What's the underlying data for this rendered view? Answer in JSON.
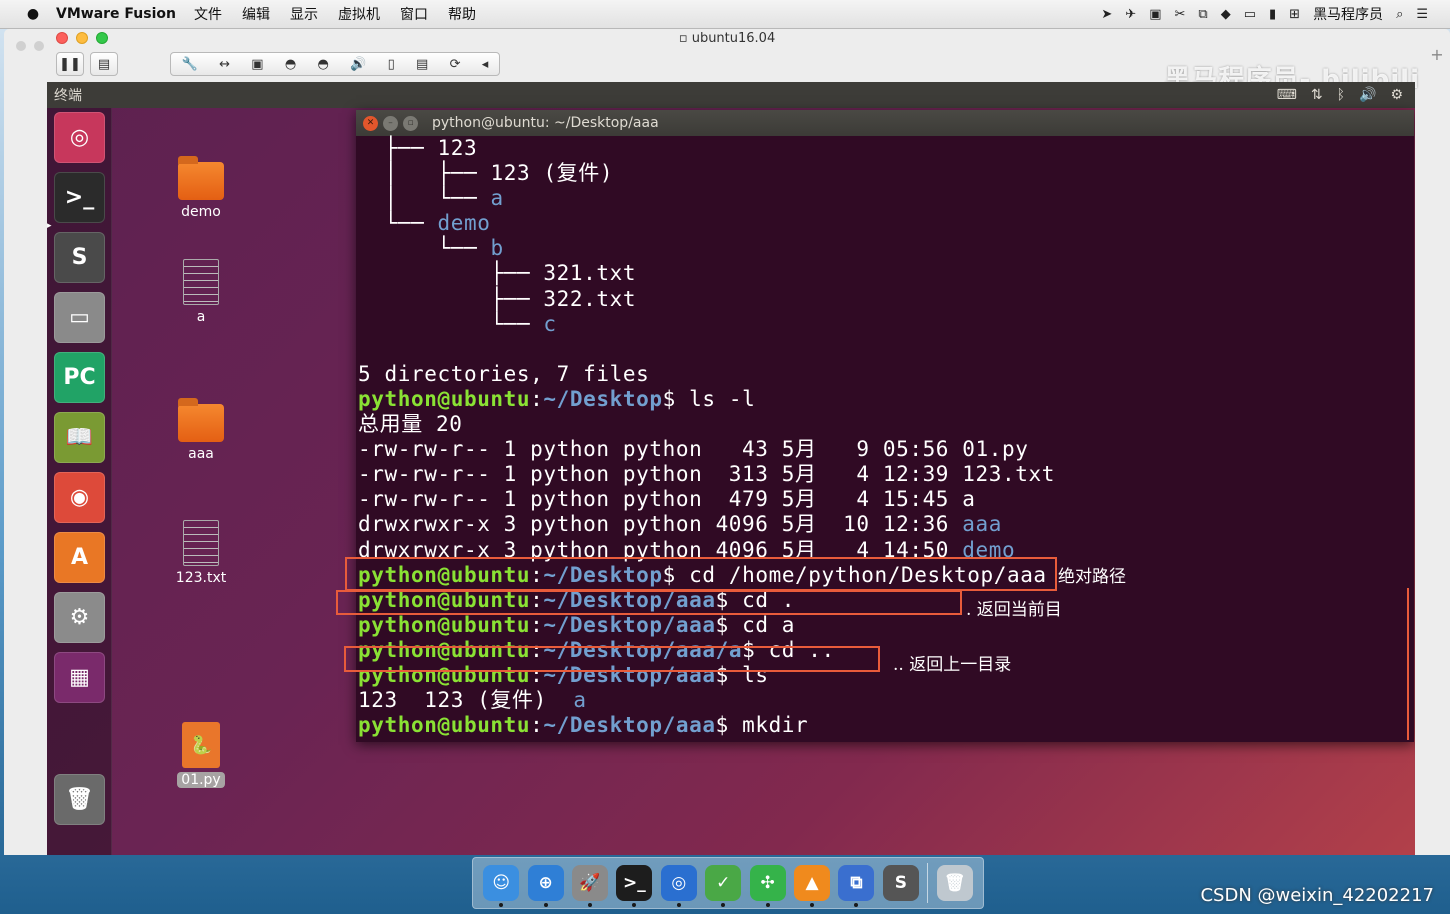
{
  "mac_menubar": {
    "app_name": "VMware Fusion",
    "menus": [
      "文件",
      "编辑",
      "显示",
      "虚拟机",
      "窗口",
      "帮助"
    ],
    "status_user": "黑马程序员"
  },
  "vm": {
    "title": "ubuntu16.04",
    "watermark": "黑马程序员- bilibili"
  },
  "ubuntu": {
    "panel_title": "终端",
    "launcher_items": [
      {
        "name": "ubuntu-dash",
        "glyph": "◎",
        "color": "#c7375c"
      },
      {
        "name": "terminal",
        "glyph": ">_",
        "color": "#2b2b2b"
      },
      {
        "name": "sublime-text",
        "glyph": "S",
        "color": "#4a4a4a"
      },
      {
        "name": "file-manager",
        "glyph": "▭",
        "color": "#8a8a8a"
      },
      {
        "name": "pycharm",
        "glyph": "PC",
        "color": "#21a366"
      },
      {
        "name": "ebook-reader",
        "glyph": "📖",
        "color": "#7a9a33"
      },
      {
        "name": "chrome",
        "glyph": "◉",
        "color": "#dd4a3a"
      },
      {
        "name": "software-center",
        "glyph": "A",
        "color": "#e97725"
      },
      {
        "name": "system-settings",
        "glyph": "⚙",
        "color": "#8b8b8b"
      },
      {
        "name": "workspace-switcher",
        "glyph": "▦",
        "color": "#7a2a6b"
      },
      {
        "name": "trash",
        "glyph": "🗑",
        "color": "#6a6a6a"
      }
    ],
    "desktop_icons": [
      {
        "label": "demo",
        "kind": "folder"
      },
      {
        "label": "a",
        "kind": "file"
      },
      {
        "label": "aaa",
        "kind": "folder"
      },
      {
        "label": "123.txt",
        "kind": "file"
      },
      {
        "label": "01.py",
        "kind": "python"
      }
    ]
  },
  "terminal": {
    "title": "python@ubuntu: ~/Desktop/aaa",
    "lines": [
      [
        {
          "t": "  ",
          "c": ""
        },
        {
          "t": "├── ",
          "c": "tr"
        },
        {
          "t": "123",
          "c": ""
        }
      ],
      [
        {
          "t": "  ",
          "c": ""
        },
        {
          "t": "│   ",
          "c": "tr"
        },
        {
          "t": "├── ",
          "c": "tr"
        },
        {
          "t": "123 (复件)",
          "c": ""
        }
      ],
      [
        {
          "t": "  ",
          "c": ""
        },
        {
          "t": "│   ",
          "c": "tr"
        },
        {
          "t": "└── ",
          "c": "tr"
        },
        {
          "t": "a",
          "c": "dir"
        }
      ],
      [
        {
          "t": "  ",
          "c": ""
        },
        {
          "t": "└── ",
          "c": "tr"
        },
        {
          "t": "demo",
          "c": "dir"
        }
      ],
      [
        {
          "t": "      ",
          "c": ""
        },
        {
          "t": "└── ",
          "c": "tr"
        },
        {
          "t": "b",
          "c": "dir"
        }
      ],
      [
        {
          "t": "          ",
          "c": ""
        },
        {
          "t": "├── ",
          "c": "tr"
        },
        {
          "t": "321.txt",
          "c": ""
        }
      ],
      [
        {
          "t": "          ",
          "c": ""
        },
        {
          "t": "├── ",
          "c": "tr"
        },
        {
          "t": "322.txt",
          "c": ""
        }
      ],
      [
        {
          "t": "          ",
          "c": ""
        },
        {
          "t": "└── ",
          "c": "tr"
        },
        {
          "t": "c",
          "c": "dir"
        }
      ],
      [
        {
          "t": "",
          "c": ""
        }
      ],
      [
        {
          "t": "5 directories, 7 files",
          "c": ""
        }
      ],
      [
        {
          "t": "python@ubuntu",
          "c": "pu"
        },
        {
          "t": ":",
          "c": ""
        },
        {
          "t": "~/Desktop",
          "c": "pp"
        },
        {
          "t": "$ ls -l",
          "c": ""
        }
      ],
      [
        {
          "t": "总用量 20",
          "c": ""
        }
      ],
      [
        {
          "t": "-rw-rw-r-- 1 python python   43 5月   9 05:56 01.py",
          "c": ""
        }
      ],
      [
        {
          "t": "-rw-rw-r-- 1 python python  313 5月   4 12:39 123.txt",
          "c": ""
        }
      ],
      [
        {
          "t": "-rw-rw-r-- 1 python python  479 5月   4 15:45 a",
          "c": ""
        }
      ],
      [
        {
          "t": "drwxrwxr-x 3 python python 4096 5月  10 12:36 ",
          "c": ""
        },
        {
          "t": "aaa",
          "c": "dir"
        }
      ],
      [
        {
          "t": "drwxrwxr-x 3 python python 4096 5月   4 14:50 ",
          "c": ""
        },
        {
          "t": "demo",
          "c": "dir"
        }
      ],
      [
        {
          "t": "python@ubuntu",
          "c": "pu"
        },
        {
          "t": ":",
          "c": ""
        },
        {
          "t": "~/Desktop",
          "c": "pp"
        },
        {
          "t": "$ cd /home/python/Desktop/aaa",
          "c": ""
        }
      ],
      [
        {
          "t": "python@ubuntu",
          "c": "pu"
        },
        {
          "t": ":",
          "c": ""
        },
        {
          "t": "~/Desktop/aaa",
          "c": "pp"
        },
        {
          "t": "$ cd .",
          "c": ""
        }
      ],
      [
        {
          "t": "python@ubuntu",
          "c": "pu"
        },
        {
          "t": ":",
          "c": ""
        },
        {
          "t": "~/Desktop/aaa",
          "c": "pp"
        },
        {
          "t": "$ cd a",
          "c": ""
        }
      ],
      [
        {
          "t": "python@ubuntu",
          "c": "pu"
        },
        {
          "t": ":",
          "c": ""
        },
        {
          "t": "~/Desktop/aaa/a",
          "c": "pp"
        },
        {
          "t": "$ cd ..",
          "c": ""
        }
      ],
      [
        {
          "t": "python@ubuntu",
          "c": "pu"
        },
        {
          "t": ":",
          "c": ""
        },
        {
          "t": "~/Desktop/aaa",
          "c": "pp"
        },
        {
          "t": "$ ls",
          "c": ""
        }
      ],
      [
        {
          "t": "123  123 (复件)  ",
          "c": ""
        },
        {
          "t": "a",
          "c": "dir"
        }
      ],
      [
        {
          "t": "python@ubuntu",
          "c": "pu"
        },
        {
          "t": ":",
          "c": ""
        },
        {
          "t": "~/Desktop/aaa",
          "c": "pp"
        },
        {
          "t": "$ mkdir",
          "c": ""
        }
      ]
    ]
  },
  "annotations": {
    "absolute_path": "绝对路径",
    "current_dir": ". 返回当前目",
    "parent_dir": ".. 返回上一目录"
  },
  "dock": {
    "items": [
      {
        "name": "finder",
        "glyph": "☺",
        "color": "#3b8fe0"
      },
      {
        "name": "safari",
        "glyph": "⊕",
        "color": "#2f7fd6"
      },
      {
        "name": "launchpad",
        "glyph": "🚀",
        "color": "#8a8a8a"
      },
      {
        "name": "terminal",
        "glyph": ">_",
        "color": "#1d1d1d"
      },
      {
        "name": "quicktime",
        "glyph": "◎",
        "color": "#2a6fd0"
      },
      {
        "name": "maps",
        "glyph": "✓",
        "color": "#4aa846"
      },
      {
        "name": "xmind",
        "glyph": "✣",
        "color": "#35b34a"
      },
      {
        "name": "vlc",
        "glyph": "▲",
        "color": "#f08a1d"
      },
      {
        "name": "vmware",
        "glyph": "⧉",
        "color": "#3a6fcf"
      },
      {
        "name": "sublime",
        "glyph": "S",
        "color": "#555"
      },
      {
        "name": "trash",
        "glyph": "🗑",
        "color": "#bfc8cf"
      }
    ]
  },
  "footer_watermark": "CSDN @weixin_42202217"
}
